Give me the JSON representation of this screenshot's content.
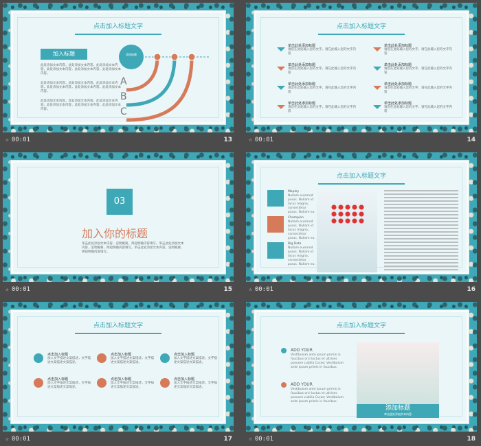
{
  "slides": [
    {
      "number": "13",
      "time": "00:01",
      "title": "点击加入标题文字",
      "btn": "加入标题",
      "circle": "添加标题",
      "letters": [
        "A",
        "B",
        "C"
      ],
      "dots": [
        "a",
        "b",
        "c"
      ],
      "bodies": [
        "此处添加文本内容，此处添加文本内容，此处添加文本内容，此处添加文本内容，此处添加文本内容，此处添加文本内容。",
        "此处添加文本内容，此处添加文本内容，此处添加文本内容，此处添加文本内容，此处添加文本内容，此处添加文本内容。",
        "此处添加文本内容，此处添加文本内容，此处添加文本内容，此处添加文本内容，此处添加文本内容，此处添加文本内容。"
      ]
    },
    {
      "number": "14",
      "time": "00:01",
      "title": "点击加入标题文字",
      "item_title": "单击此处添加标题",
      "item_text": "请您在此处输入您的文字，请在此输入您的文字内容"
    },
    {
      "number": "15",
      "time": "00:01",
      "section_no": "03",
      "heading": "加入你的标题",
      "body": "单击此处添加文本内容，说明概要，简短明确内容填写。单击此处添加文本内容，说明概要，简短明确内容填写。单击此处添加文本内容，说明概要，简短明确内容填写。"
    },
    {
      "number": "16",
      "time": "00:01",
      "title": "点击加入标题文字",
      "items": [
        {
          "label": "Mapley",
          "text": "Nullam euismod purus. Nullam id lacus magna, consectetur purus. Nullam eu."
        },
        {
          "label": "Champion",
          "text": "Nullam euismod purus. Nullam id lacus magna, consectetur purus. Nullam eu."
        },
        {
          "label": "Big Data",
          "text": "Nullam euismod purus. Nullam id lacus magna, consectetur purus. Nullam eu."
        }
      ]
    },
    {
      "number": "17",
      "time": "00:01",
      "title": "点击加入标题文字",
      "item_title": "点击加入标题",
      "item_text": "加入文字描述文案描述，文字描述文案描述文案描述。"
    },
    {
      "number": "18",
      "time": "00:01",
      "title": "点击加入标题文字",
      "add_your": "ADD YOUR",
      "caption": "添加标题",
      "caption_sub": "单击此处添加文本内容",
      "body": "Vestibulum ante ipsum primis in faucibus orci luctus et ultrices posuere cubilia Curae; Vestibulum ante ipsum primis in faucibus."
    }
  ],
  "colors": {
    "teal": "#3ea8b6",
    "orange": "#d77a5a",
    "bg": "#eaf6f8"
  }
}
